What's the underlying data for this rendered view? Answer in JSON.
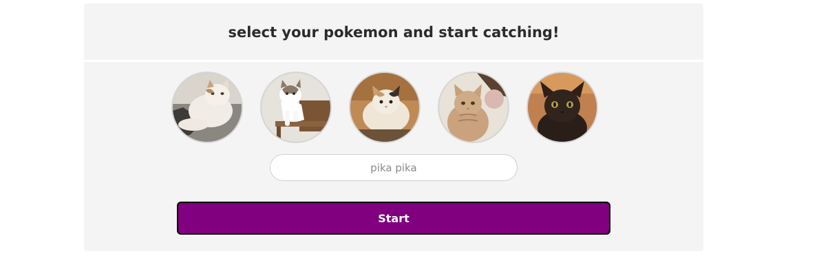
{
  "header": {
    "title": "select your pokemon and start catching!"
  },
  "pokemon_options": [
    {
      "name": "cat-avatar-1",
      "icon": "cat-photo-icon"
    },
    {
      "name": "cat-avatar-2",
      "icon": "cat-photo-icon"
    },
    {
      "name": "cat-avatar-3",
      "icon": "cat-photo-icon"
    },
    {
      "name": "cat-avatar-4",
      "icon": "cat-photo-icon"
    },
    {
      "name": "cat-avatar-5",
      "icon": "cat-photo-icon"
    }
  ],
  "name_input": {
    "placeholder": "pika pika",
    "value": ""
  },
  "start_button": {
    "label": "Start"
  },
  "colors": {
    "card_background": "#f4f4f4",
    "button_background": "#800080",
    "button_border": "#000000",
    "button_text": "#ffffff"
  }
}
